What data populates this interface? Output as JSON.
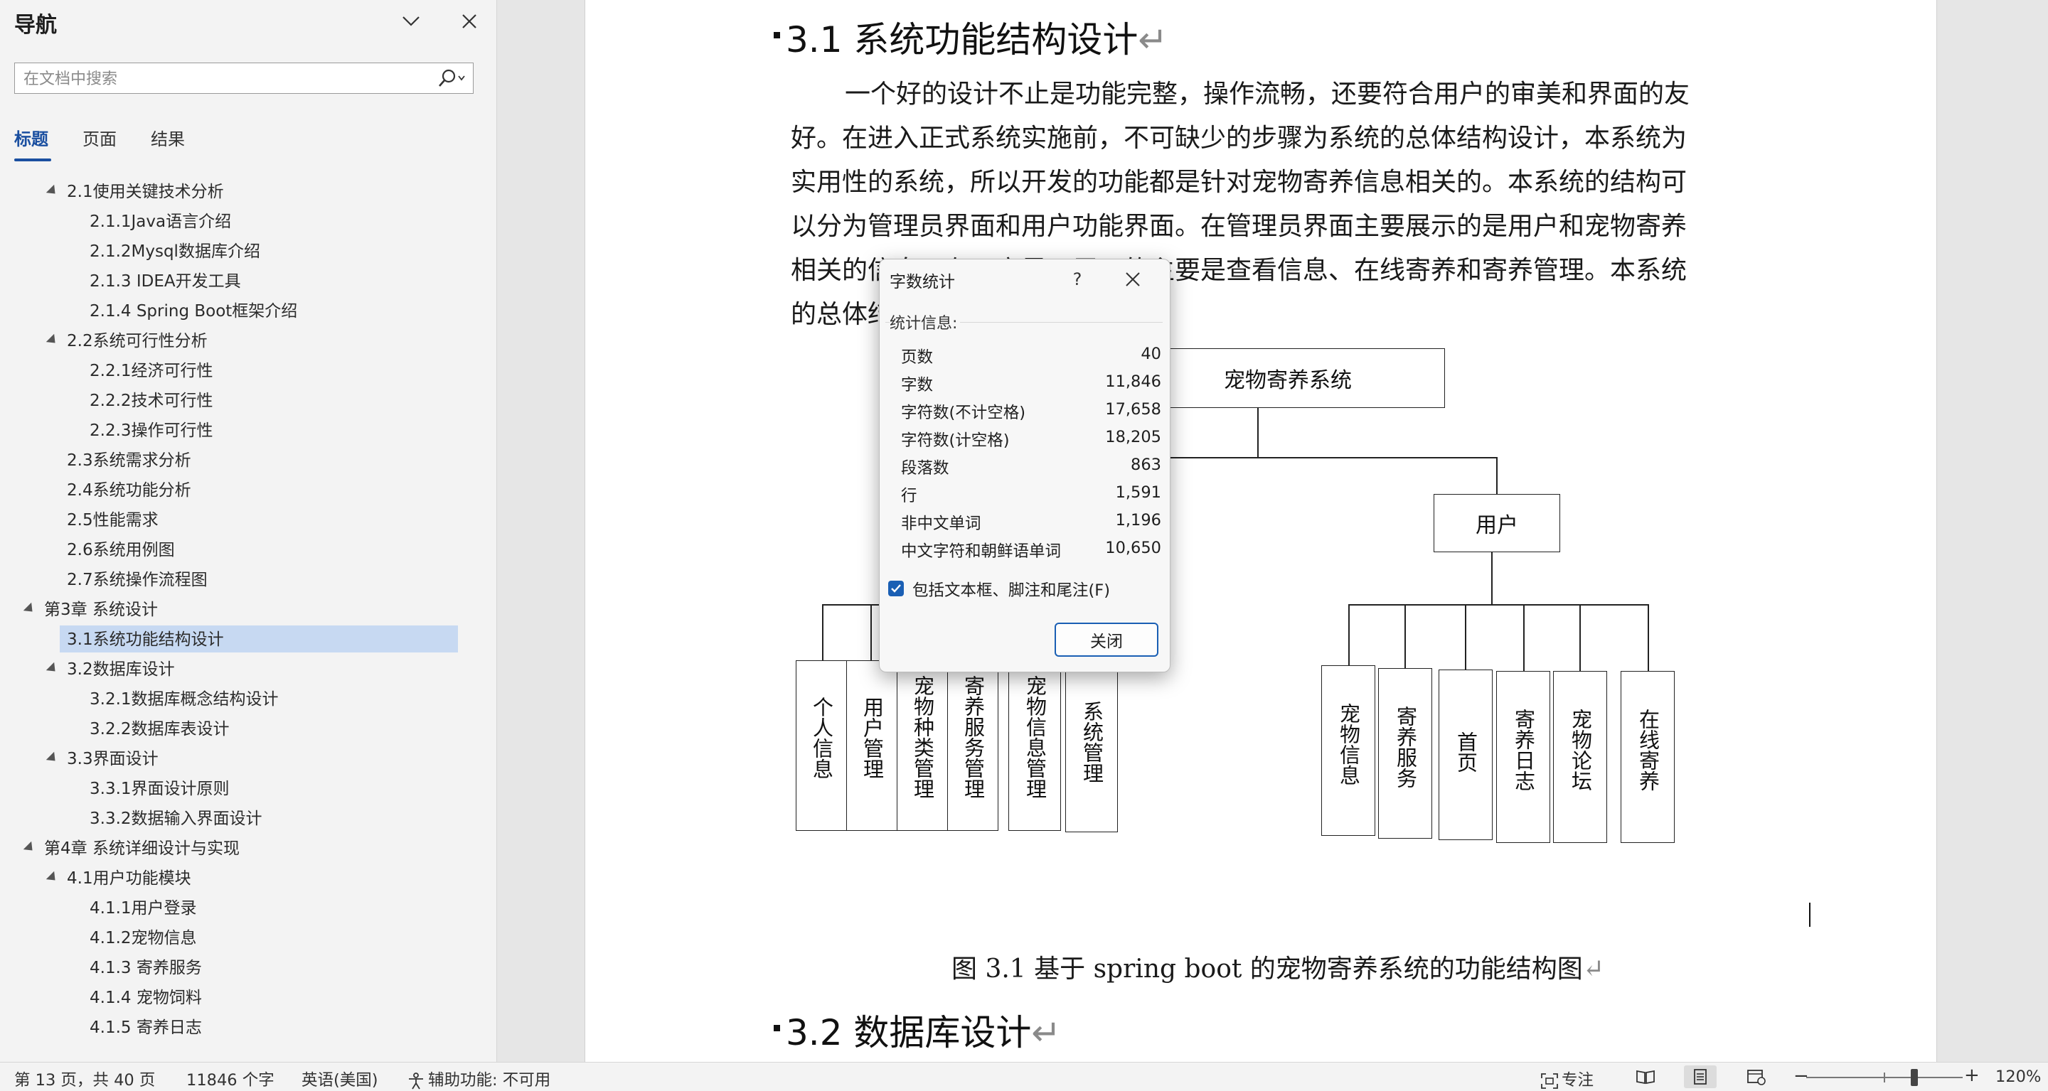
{
  "nav": {
    "title": "导航",
    "search_placeholder": "在文档中搜索",
    "tabs": [
      {
        "label": "标题",
        "active": true
      },
      {
        "label": "页面",
        "active": false
      },
      {
        "label": "结果",
        "active": false
      }
    ],
    "tree": [
      {
        "label": "2.1使用关键技术分析",
        "level": 2,
        "expanded": true
      },
      {
        "label": "2.1.1Java语言介绍",
        "level": 3
      },
      {
        "label": "2.1.2Mysql数据库介绍",
        "level": 3
      },
      {
        "label": "2.1.3 IDEA开发工具",
        "level": 3
      },
      {
        "label": "2.1.4 Spring Boot框架介绍",
        "level": 3
      },
      {
        "label": "2.2系统可行性分析",
        "level": 2,
        "expanded": true
      },
      {
        "label": "2.2.1经济可行性",
        "level": 3
      },
      {
        "label": "2.2.2技术可行性",
        "level": 3
      },
      {
        "label": "2.2.3操作可行性",
        "level": 3
      },
      {
        "label": "2.3系统需求分析",
        "level": 2
      },
      {
        "label": "2.4系统功能分析",
        "level": 2
      },
      {
        "label": "2.5性能需求",
        "level": 2
      },
      {
        "label": "2.6系统用例图",
        "level": 2
      },
      {
        "label": "2.7系统操作流程图",
        "level": 2
      },
      {
        "label": "第3章 系统设计",
        "level": 1,
        "expanded": true
      },
      {
        "label": "3.1系统功能结构设计",
        "level": 2,
        "selected": true
      },
      {
        "label": "3.2数据库设计",
        "level": 2,
        "expanded": true
      },
      {
        "label": "3.2.1数据库概念结构设计",
        "level": 3
      },
      {
        "label": "3.2.2数据库表设计",
        "level": 3
      },
      {
        "label": "3.3界面设计",
        "level": 2,
        "expanded": true
      },
      {
        "label": "3.3.1界面设计原则",
        "level": 3
      },
      {
        "label": "3.3.2数据输入界面设计",
        "level": 3
      },
      {
        "label": "第4章 系统详细设计与实现",
        "level": 1,
        "expanded": true
      },
      {
        "label": "4.1用户功能模块",
        "level": 2,
        "expanded": true
      },
      {
        "label": "4.1.1用户登录",
        "level": 3
      },
      {
        "label": "4.1.2宠物信息",
        "level": 3
      },
      {
        "label": "4.1.3 寄养服务",
        "level": 3
      },
      {
        "label": "4.1.4 宠物饲料",
        "level": 3
      },
      {
        "label": "4.1.5 寄养日志",
        "level": 3
      }
    ]
  },
  "document": {
    "heading_31": "3.1 系统功能结构设计",
    "paragraph_lines": [
      "一个好的设计不止是功能完整，操作流畅，还要符合用户的审美和界面的友",
      "好。在进入正式系统实施前，不可缺少的步骤为系统的总体结构设计，本系统为",
      "实用性的系统，所以开发的功能都是针对宠物寄养信息相关的。本系统的结构可",
      "以分为管理员界面和用户功能界面。在管理员界面主要展示的是用户和宠物寄养",
      "相关的信息，在用户界面展示的主要是查看信息、在线寄养和寄养管理。本系统",
      "的总体结构设计如下图所示。"
    ],
    "diagram": {
      "root": "宠物寄养系统",
      "user_node": "用户",
      "admin_children": [
        "个人信息",
        "用户管理",
        "宠物种类管理",
        "寄养服务管理",
        "宠物信息管理",
        "系统管理"
      ],
      "user_children": [
        "宠物信息",
        "寄养服务",
        "首页",
        "寄养日志",
        "宠物论坛",
        "在线寄养"
      ]
    },
    "caption": "图 3.1 基于 spring boot 的宠物寄养系统的功能结构图",
    "heading_32": "3.2 数据库设计",
    "paragraph_mark": "↵"
  },
  "dialog": {
    "title": "字数统计",
    "help": "?",
    "stats_label": "统计信息:",
    "stats": [
      {
        "name": "页数",
        "value": "40"
      },
      {
        "name": "字数",
        "value": "11,846"
      },
      {
        "name": "字符数(不计空格)",
        "value": "17,658"
      },
      {
        "name": "字符数(计空格)",
        "value": "18,205"
      },
      {
        "name": "段落数",
        "value": "863"
      },
      {
        "name": "行",
        "value": "1,591"
      },
      {
        "name": "非中文单词",
        "value": "1,196"
      },
      {
        "name": "中文字符和朝鲜语单词",
        "value": "10,650"
      }
    ],
    "include_label": "包括文本框、脚注和尾注(F)",
    "include_checked": true,
    "close_label": "关闭"
  },
  "statusbar": {
    "page_info": "第 13 页，共 40 页",
    "word_count": "11846 个字",
    "language": "英语(美国)",
    "accessibility": "辅助功能: 不可用",
    "focus": "专注",
    "zoom_minus": "−",
    "zoom_plus": "+",
    "zoom_level": "120%",
    "zoom_percent": 120
  },
  "colors": {
    "accent": "#1a5fb4",
    "tab_active": "#1a4fa0",
    "selected_item": "#c7d9f2"
  }
}
